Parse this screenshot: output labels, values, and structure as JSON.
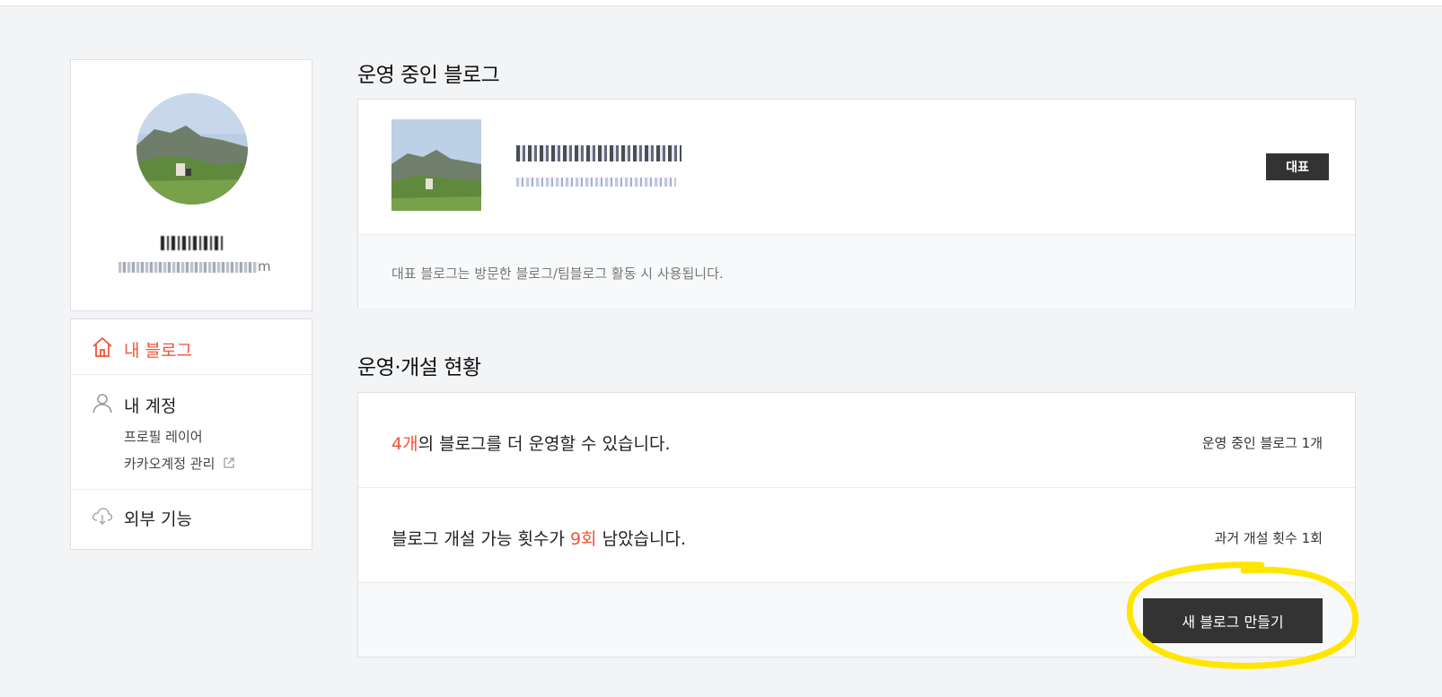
{
  "profile": {
    "mail_tail": "m"
  },
  "nav": {
    "my_blog": "내 블로그",
    "my_account": "내 계정",
    "profile_layer": "프로필 레이어",
    "kakao_account": "카카오계정 관리",
    "external": "외부 기능"
  },
  "sections": {
    "running_title": "운영 중인 블로그",
    "status_title": "운영·개설 현황"
  },
  "blog": {
    "rep_badge": "대표",
    "note": "대표 블로그는 방문한 블로그/팀블로그 활동 시 사용됩니다."
  },
  "status": {
    "row1_count": "4개",
    "row1_text": "의 블로그를 더 운영할 수 있습니다.",
    "row1_side": "운영 중인 블로그 1개",
    "row2_text_a": "블로그 개설 가능 횟수가 ",
    "row2_count": "9회",
    "row2_text_b": " 남았습니다.",
    "row2_side": "과거 개설 횟수 1회",
    "new_blog": "새 블로그 만들기"
  },
  "colors": {
    "accent": "#f0553a",
    "highlight": "#ffe600",
    "button": "#333333"
  }
}
